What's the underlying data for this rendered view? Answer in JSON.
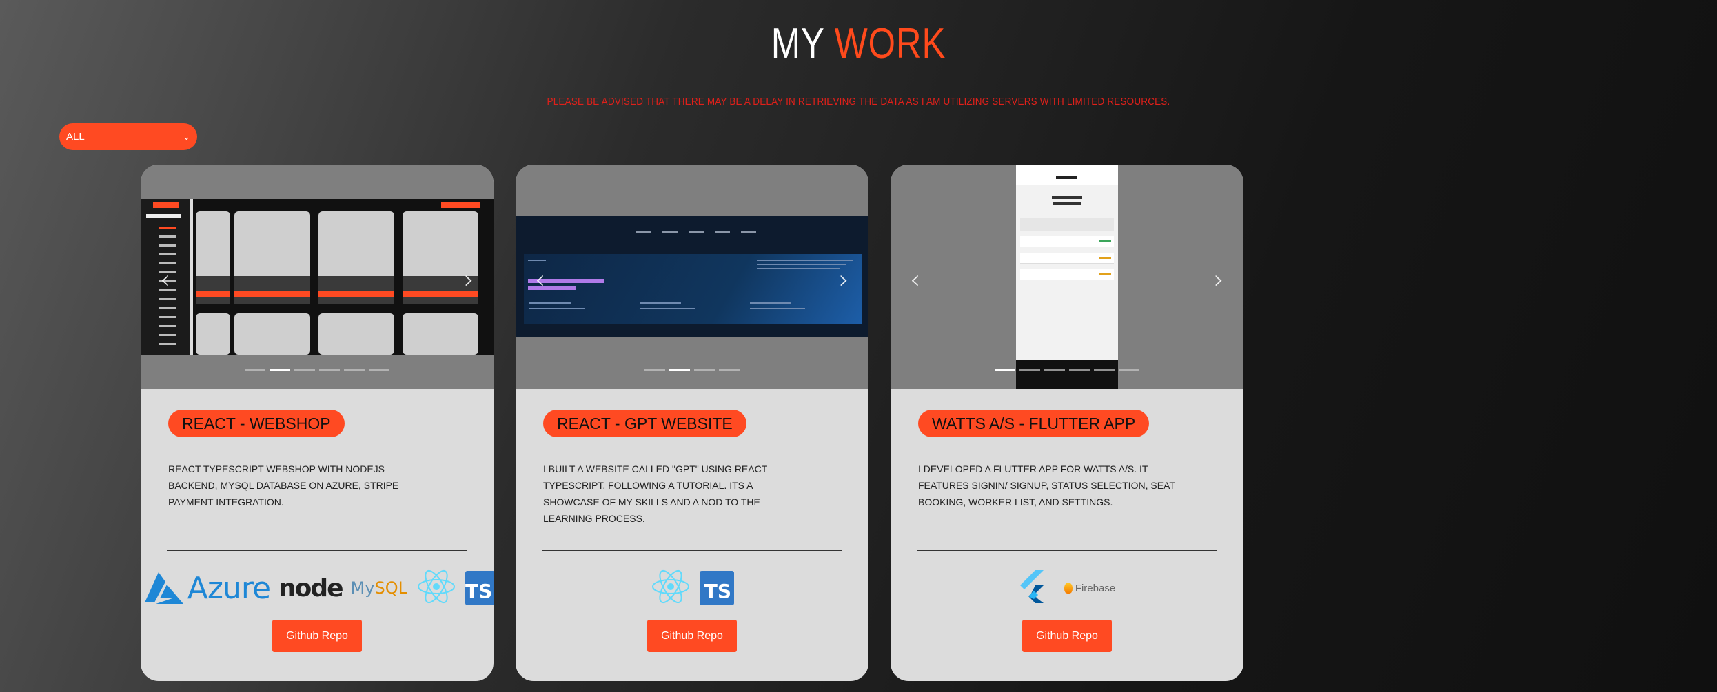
{
  "header": {
    "title_part1": "MY",
    "title_part2": "WORK",
    "notice": "PLEASE BE ADVISED THAT THERE MAY BE A DELAY IN RETRIEVING THE DATA AS I AM UTILIZING SERVERS WITH LIMITED RESOURCES."
  },
  "filter": {
    "selected": "ALL",
    "icon": "chevron-down-icon"
  },
  "colors": {
    "accent": "#ff4a22",
    "notice": "#e0201a",
    "card_bg": "#dcdcdc"
  },
  "projects": [
    {
      "title": "REACT - WEBSHOP",
      "description": "REACT TYPESCRIPT WEBSHOP WITH NODEJS BACKEND, MYSQL DATABASE ON AZURE, STRIPE PAYMENT INTEGRATION.",
      "button": "Github Repo",
      "carousel_slides": 6,
      "active_slide": 2,
      "preview": {
        "menu_button": "Close Menu",
        "filter_button": "Price: High to Low",
        "categories_heading": "Categories",
        "products": [
          "Product 2",
          "Product 3",
          "Product 4"
        ],
        "buy": "Buy",
        "learn_more": "Learn more"
      },
      "tech": [
        "Azure",
        "node",
        "MySQL",
        "react-icon",
        "TS"
      ]
    },
    {
      "title": "REACT - GPT WEBSITE",
      "description": "I BUILT A WEBSITE CALLED \"GPT\" USING REACT TYPESCRIPT, FOLLOWING A TUTORIAL. ITS A SHOWCASE OF MY SKILLS AND A NOD TO THE LEARNING PROCESS.",
      "button": "Github Repo",
      "carousel_slides": 4,
      "active_slide": 2,
      "preview": {
        "headline": "The possibilities are beyond your imagination"
      },
      "tech": [
        "react-icon",
        "TS"
      ]
    },
    {
      "title": "WATTS A/S - FLUTTER APP",
      "description": "I DEVELOPED A FLUTTER APP FOR WATTS A/S. IT FEATURES SIGNIN/ SIGNUP, STATUS SELECTION, SEAT BOOKING, WORKER LIST, AND SETTINGS.",
      "button": "Github Repo",
      "carousel_slides": 6,
      "active_slide": 1,
      "preview": {
        "screen_title": "Liste",
        "day": "Torsdag",
        "date": "09-02-2023"
      },
      "tech": [
        "flutter-icon",
        "Firebase"
      ]
    }
  ]
}
